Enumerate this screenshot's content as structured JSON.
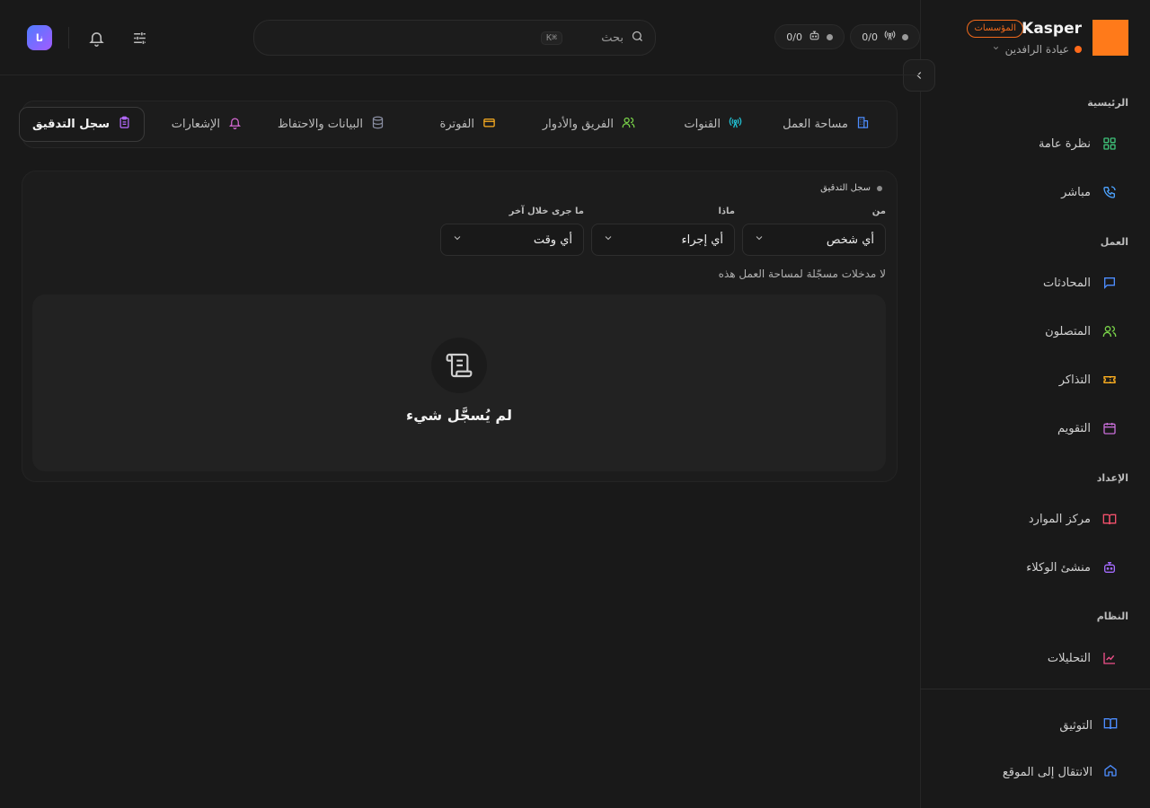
{
  "brand": {
    "name": "Kasper",
    "badge": "المؤسسات",
    "org": "عيادة الرافدين",
    "logo_color": "#ff7a1a"
  },
  "sidebar": {
    "sections": [
      {
        "title": "الرئيسية",
        "items": [
          {
            "label": "نظرة عامة",
            "icon": "grid-icon",
            "color": "#3fc37a"
          },
          {
            "label": "مباشر",
            "icon": "phone-icon",
            "color": "#4da3ff"
          }
        ]
      },
      {
        "title": "العمل",
        "items": [
          {
            "label": "المحادثات",
            "icon": "message-icon",
            "color": "#4d8dff"
          },
          {
            "label": "المتصلون",
            "icon": "users-icon",
            "color": "#7bd64a"
          },
          {
            "label": "التذاكر",
            "icon": "ticket-icon",
            "color": "#ffb020"
          },
          {
            "label": "التقويم",
            "icon": "calendar-icon",
            "color": "#c66dd6"
          }
        ]
      },
      {
        "title": "الإعداد",
        "items": [
          {
            "label": "مركز الموارد",
            "icon": "book-icon",
            "color": "#f2506b"
          },
          {
            "label": "منشئ الوكلاء",
            "icon": "bot-icon",
            "color": "#a46bff"
          }
        ]
      },
      {
        "title": "النظام",
        "items": [
          {
            "label": "التحليلات",
            "icon": "chart-icon",
            "color": "#f0508a"
          }
        ]
      }
    ],
    "footer": [
      {
        "label": "التوثيق",
        "icon": "book-open-icon",
        "color": "#4d8dff"
      },
      {
        "label": "الانتقال إلى الموقع",
        "icon": "home-icon",
        "color": "#4d8dff"
      }
    ]
  },
  "topbar": {
    "counters": [
      {
        "value": "0/0",
        "icon": "antenna-icon"
      },
      {
        "value": "0/0",
        "icon": "bot-icon"
      }
    ],
    "search": {
      "placeholder": "بحث",
      "shortcut": "⌘K"
    },
    "avatar": "نا"
  },
  "tabs": [
    {
      "label": "مساحة العمل",
      "icon": "building-icon",
      "color": "#4d8dff",
      "active": false
    },
    {
      "label": "القنوات",
      "icon": "antenna-icon",
      "color": "#22c3d6",
      "active": false
    },
    {
      "label": "الفريق والأدوار",
      "icon": "users-icon",
      "color": "#7bd64a",
      "active": false
    },
    {
      "label": "الفوترة",
      "icon": "credit-card-icon",
      "color": "#ffb020",
      "active": false
    },
    {
      "label": "البيانات والاحتفاظ",
      "icon": "database-icon",
      "color": "#8a8fa3",
      "active": false
    },
    {
      "label": "الإشعارات",
      "icon": "bell-icon",
      "color": "#d86ad6",
      "active": false
    },
    {
      "label": "سجل التدقيق",
      "icon": "clipboard-icon",
      "color": "#b66bff",
      "active": true
    }
  ],
  "audit": {
    "title": "سجل التدقيق",
    "filters": [
      {
        "label": "من",
        "value": "أي شخص"
      },
      {
        "label": "ماذا",
        "value": "أي إجراء"
      },
      {
        "label": "ما جرى خلال آخر",
        "value": "أي وقت"
      }
    ],
    "empty_note": "لا مدخلات مسجّلة لمساحة العمل هذه",
    "empty_title": "لم يُسجَّل شيء"
  }
}
